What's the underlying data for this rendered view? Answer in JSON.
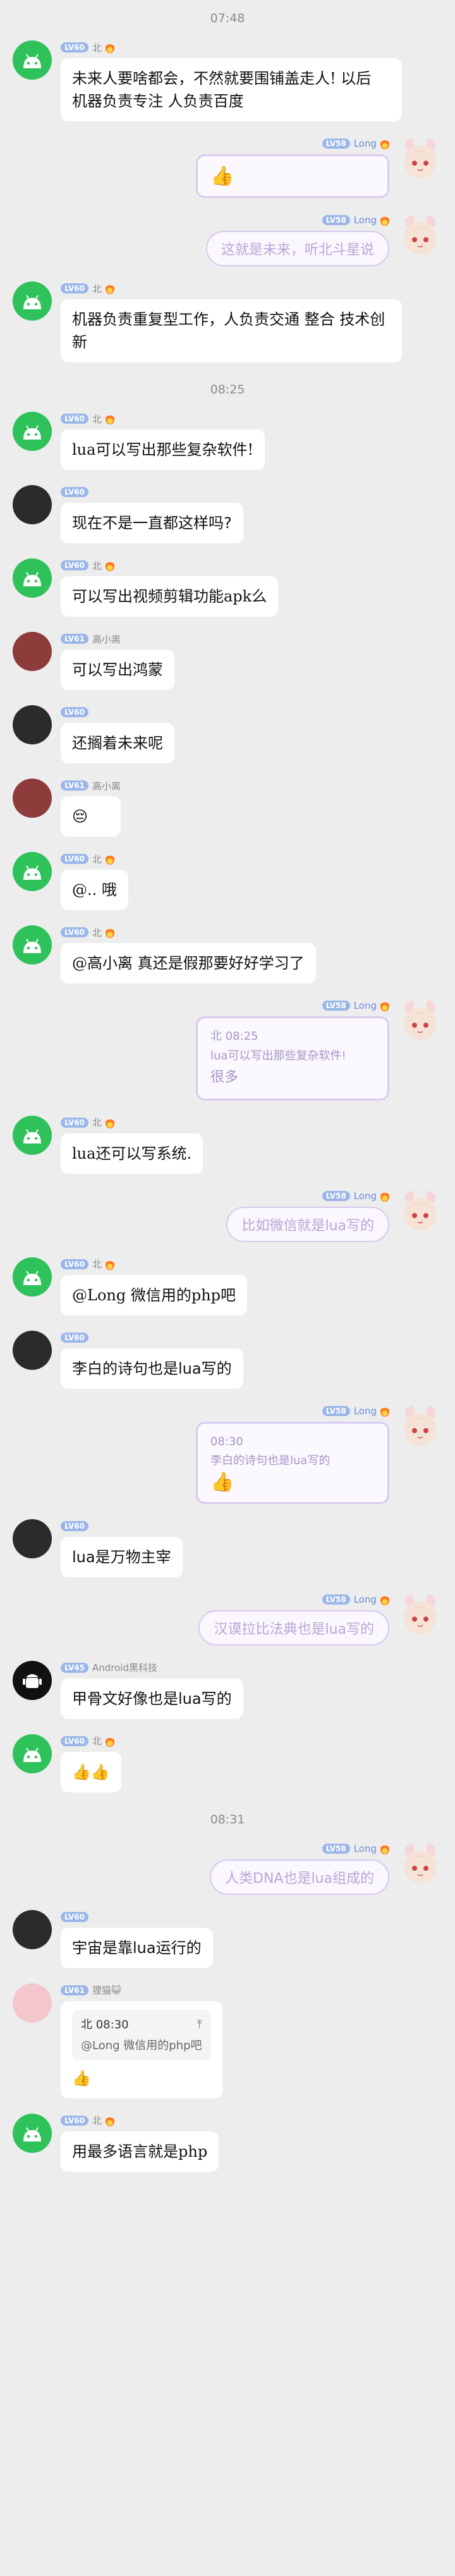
{
  "messages": [
    {
      "type": "time",
      "text": "07:48"
    },
    {
      "type": "msg",
      "side": "left",
      "avatar": "android",
      "level": "LV60",
      "name": "北",
      "flame": true,
      "text": "未来人要啥都会，不然就要围铺盖走人!  以后 机器负责专注  人负责百度",
      "hand": true
    },
    {
      "type": "msg",
      "side": "right",
      "avatar": "anime",
      "level": "LV58",
      "name": "Long",
      "emoji": "👍",
      "frame": true
    },
    {
      "type": "msg",
      "side": "right",
      "avatar": "anime",
      "level": "LV58",
      "name": "Long",
      "pill": "这就是未来，听北斗星说"
    },
    {
      "type": "msg",
      "side": "left",
      "avatar": "android",
      "level": "LV60",
      "name": "北",
      "flame": true,
      "text": "机器负责重复型工作，人负责交通  整合  技术创新",
      "hand": true
    },
    {
      "type": "time",
      "text": "08:25"
    },
    {
      "type": "msg",
      "side": "left",
      "avatar": "android",
      "level": "LV60",
      "name": "北",
      "flame": true,
      "text": "lua可以写出那些复杂软件!",
      "hand": true
    },
    {
      "type": "msg",
      "side": "left",
      "avatar": "dark",
      "level": "LV60",
      "name": "",
      "text": "现在不是一直都这样吗?"
    },
    {
      "type": "msg",
      "side": "left",
      "avatar": "android",
      "level": "LV60",
      "name": "北",
      "flame": true,
      "text": "可以写出视频剪辑功能apk么",
      "hand": true
    },
    {
      "type": "msg",
      "side": "left",
      "avatar": "girl",
      "level": "LV61",
      "name": "高小离",
      "text": "可以写出鸿蒙"
    },
    {
      "type": "msg",
      "side": "left",
      "avatar": "dark",
      "level": "LV60",
      "name": "",
      "text": "还搁着未来呢"
    },
    {
      "type": "msg",
      "side": "left",
      "avatar": "girl",
      "level": "LV61",
      "name": "高小离",
      "text": "😔"
    },
    {
      "type": "msg",
      "side": "left",
      "avatar": "android",
      "level": "LV60",
      "name": "北",
      "flame": true,
      "text": "@.. 哦",
      "hand": true
    },
    {
      "type": "msg",
      "side": "left",
      "avatar": "android",
      "level": "LV60",
      "name": "北",
      "flame": true,
      "text": "@高小离 真还是假那要好好学习了",
      "hand": true
    },
    {
      "type": "msg",
      "side": "right",
      "avatar": "anime",
      "level": "LV58",
      "name": "Long",
      "quote_title": "北 08:25",
      "quote_text": "lua可以写出那些复杂软件!",
      "text": "很多",
      "frame": true
    },
    {
      "type": "msg",
      "side": "left",
      "avatar": "android",
      "level": "LV60",
      "name": "北",
      "flame": true,
      "text": "lua还可以写系统.",
      "hand": true
    },
    {
      "type": "msg",
      "side": "right",
      "avatar": "anime",
      "level": "LV58",
      "name": "Long",
      "pill": "比如微信就是lua写的"
    },
    {
      "type": "msg",
      "side": "left",
      "avatar": "android",
      "level": "LV60",
      "name": "北",
      "flame": true,
      "text": "@Long 微信用的php吧",
      "hand": true
    },
    {
      "type": "msg",
      "side": "left",
      "avatar": "dark",
      "level": "LV60",
      "name": "",
      "text": "李白的诗句也是lua写的"
    },
    {
      "type": "msg",
      "side": "right",
      "avatar": "anime",
      "level": "LV58",
      "name": "Long",
      "quote_title": "08:30",
      "quote_text": "李白的诗句也是lua写的",
      "emoji": "👍",
      "frame": true
    },
    {
      "type": "msg",
      "side": "left",
      "avatar": "dark",
      "level": "LV60",
      "name": "",
      "text": "lua是万物主宰"
    },
    {
      "type": "msg",
      "side": "right",
      "avatar": "anime",
      "level": "LV58",
      "name": "Long",
      "pill": "汉谟拉比法典也是lua写的"
    },
    {
      "type": "msg",
      "side": "left",
      "avatar": "bw",
      "level": "LV45",
      "name": "Android黑科技",
      "text": "甲骨文好像也是lua写的"
    },
    {
      "type": "msg",
      "side": "left",
      "avatar": "android",
      "level": "LV60",
      "name": "北",
      "flame": true,
      "text": "👍👍"
    },
    {
      "type": "time",
      "text": "08:31"
    },
    {
      "type": "msg",
      "side": "right",
      "avatar": "anime",
      "level": "LV58",
      "name": "Long",
      "pill": "人类DNA也是lua组成的"
    },
    {
      "type": "msg",
      "side": "left",
      "avatar": "dark",
      "level": "LV60",
      "name": "",
      "text": "宇宙是靠lua运行的"
    },
    {
      "type": "msg",
      "side": "left",
      "avatar": "cat",
      "level": "LV61",
      "name": "狸猫😺",
      "reply_title": "北 08:30",
      "reply_text": "@Long 微信用的php吧",
      "text": "👍"
    },
    {
      "type": "msg",
      "side": "left",
      "avatar": "android",
      "level": "LV60",
      "name": "北",
      "flame": true,
      "text": "用最多语言就是php",
      "hand": true
    }
  ]
}
